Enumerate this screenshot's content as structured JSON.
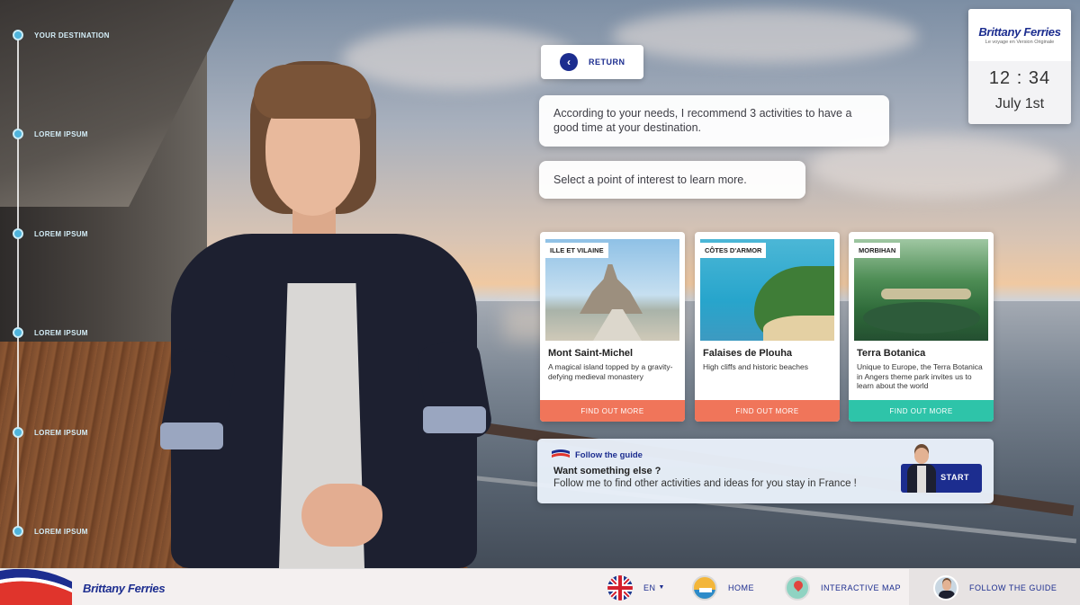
{
  "timeline": {
    "steps": [
      {
        "label": "YOUR DESTINATION"
      },
      {
        "label": "LOREM IPSUM"
      },
      {
        "label": "LOREM IPSUM"
      },
      {
        "label": "LOREM IPSUM"
      },
      {
        "label": "LOREM IPSUM"
      },
      {
        "label": "LOREM IPSUM"
      }
    ]
  },
  "return_button": {
    "label": "RETURN",
    "icon": "chevron-left-icon"
  },
  "assistant": {
    "message_1": "According to your needs, I recommend 3 activities to have a good time at your destination.",
    "message_2": "Select a point of interest to learn more."
  },
  "clock_widget": {
    "brand": "Brittany Ferries",
    "tagline": "Le voyage en Version Originale",
    "time": "12 : 34",
    "date": "July 1st"
  },
  "cards": [
    {
      "region": "ILLE ET VILAINE",
      "title": "Mont Saint-Michel",
      "description": "A magical island topped by a gravity-defying medieval monastery",
      "button": "FIND OUT MORE",
      "button_color": "#f0755a"
    },
    {
      "region": "CÔTES D'ARMOR",
      "title": "Falaises de Plouha",
      "description": "High cliffs and historic beaches",
      "button": "FIND OUT MORE",
      "button_color": "#f0755a"
    },
    {
      "region": "MORBIHAN",
      "title": "Terra Botanica",
      "description": "Unique to Europe, the Terra Botanica in Angers theme park invites us to learn about the world",
      "button": "FIND OUT MORE",
      "button_color": "#2ec4a9"
    }
  ],
  "guide_panel": {
    "title": "Follow the guide",
    "question": "Want something else ?",
    "text": "Follow me to find other activities and ideas for you stay in France !",
    "start_label": "START"
  },
  "bottom_bar": {
    "logo_text": "Brittany Ferries",
    "language": "EN",
    "home": "HOME",
    "map": "INTERACTIVE MAP",
    "guide": "FOLLOW THE GUIDE"
  },
  "colors": {
    "brand_blue": "#1c2d8f",
    "brand_red": "#e0342c",
    "timeline_dot": "#4fb4dc",
    "coral": "#f0755a",
    "teal": "#2ec4a9"
  }
}
